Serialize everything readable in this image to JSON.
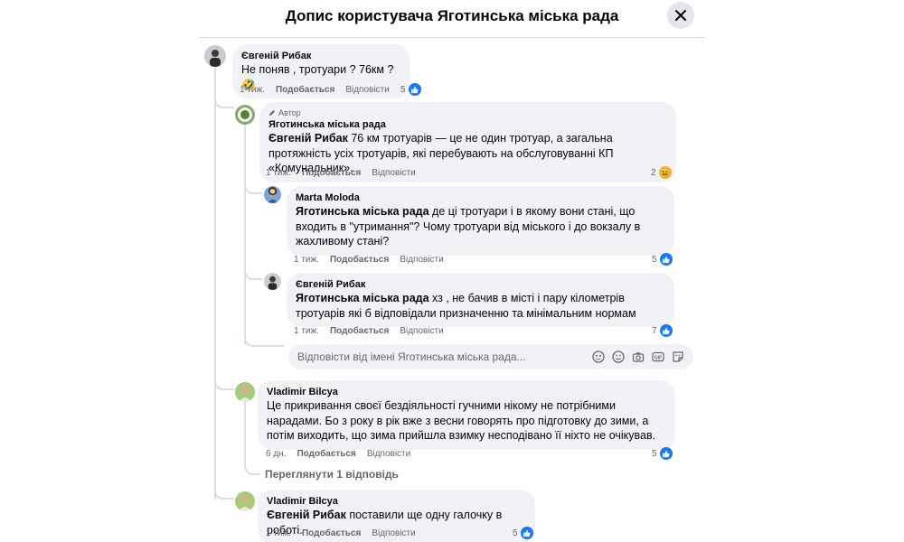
{
  "header": {
    "title": "Допис користувача Яготинська міська рада"
  },
  "comments": [
    {
      "author": "Євгеній Рибак",
      "text": "Не поняв , тротуари ? 76км ? 🤣",
      "time": "1 тиж.",
      "like_label": "Подобається",
      "reply_label": "Відповісти",
      "reactions": "5"
    },
    {
      "badge": "Автор",
      "author": "Яготинська міська рада",
      "mention": "Євгеній Рибак",
      "text": " 76 км тротуарів — це не один тротуар, а загальна протяжність усіх тротуарів, які перебувають на обслуговуванні КП «Комунальник».",
      "time": "1 тиж.",
      "like_label": "Подобається",
      "reply_label": "Відповісти",
      "reactions": "2"
    },
    {
      "author": "Marta Moloda",
      "mention": "Яготинська міська рада",
      "text": " де ці тротуари і в якому вони стані, що входить в \"утримання\"? Чому тротуари від міського і до вокзалу в жахливому стані?",
      "time": "1 тиж.",
      "like_label": "Подобається",
      "reply_label": "Відповісти",
      "reactions": "5"
    },
    {
      "author": "Євгеній Рибак",
      "mention": "Яготинська міська рада",
      "text": " хз , не бачив в місті і пару кілометрів тротуарів які б відповідали призначенню та мінімальним нормам",
      "time": "1 тиж.",
      "like_label": "Подобається",
      "reply_label": "Відповісти",
      "reactions": "7"
    },
    {
      "author": "Vladimir Bilcya",
      "text": "Це прикривання своєї бездіяльності гучними нікому не потрібними нарадами. Бо з року в рік вже з весни говорять про підготовку до зими, а потім виходить, що зима прийшла взимку несподівано її ніхто не очікував.",
      "time": "6 дн.",
      "like_label": "Подобається",
      "reply_label": "Відповісти",
      "reactions": "5"
    },
    {
      "author": "Vladimir Bilcya",
      "mention": "Євгеній Рибак",
      "text": " поставили ще одну галочку в роботі.",
      "time": "1 тиж.",
      "like_label": "Подобається",
      "reply_label": "Відповісти",
      "reactions": "5"
    }
  ],
  "reply_input": {
    "placeholder": "Відповісти від імені Яготинська міська рада..."
  },
  "view_replies": "Переглянути 1 відповідь",
  "colors": {
    "accent": "#1877f2",
    "bubble": "#f0f2f5",
    "meta": "#65676b"
  },
  "icons": [
    "close-icon",
    "pencil-icon",
    "like-icon",
    "haha-icon",
    "avatar-icon",
    "emoji-icon",
    "camera-icon",
    "gif-icon",
    "sticker-icon"
  ]
}
